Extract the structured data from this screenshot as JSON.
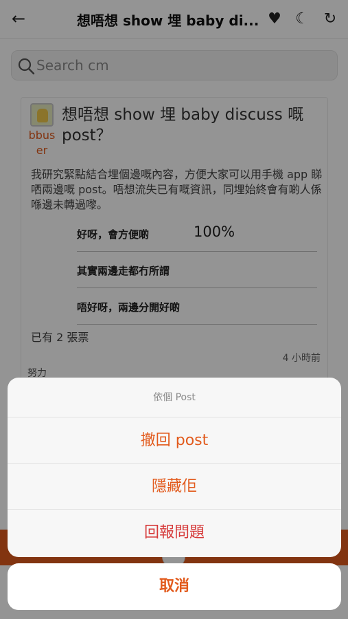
{
  "header": {
    "back_glyph": "←",
    "title": "想唔想 show 埋 baby di...",
    "icons": [
      "heart-icon",
      "moon-icon",
      "refresh-icon"
    ],
    "heart_glyph": "♥",
    "moon_glyph": "☾",
    "refresh_glyph": "↻"
  },
  "search": {
    "placeholder": "Search cm"
  },
  "post": {
    "username": "bbuser",
    "title": "想唔想 show 埋 baby discuss 嘅 post？",
    "body": "我研究緊點結合埋個邊嘅內容，方便大家可以用手機 app 睇哂兩邊嘅 post。唔想流失已有嘅資訊，同埋始終會有啲人係喺邊未轉過嚟。",
    "poll_options": [
      {
        "label": "好呀，會方便啲",
        "percent": "100%"
      },
      {
        "label": "其實兩邊走都冇所謂",
        "percent": ""
      },
      {
        "label": "唔好呀，兩邊分開好啲",
        "percent": ""
      }
    ],
    "votes": "已有 2 張票",
    "time": "4 小時前",
    "comment_peek": "努力"
  },
  "action_sheet": {
    "title": "依個 Post",
    "buttons": [
      "撤回 post",
      "隱藏佢",
      "回報問題"
    ],
    "cancel": "取消"
  },
  "colors": {
    "accent": "#e25a1c",
    "danger": "#d63a3a",
    "overlay": "rgba(0,0,0,0.42)"
  }
}
